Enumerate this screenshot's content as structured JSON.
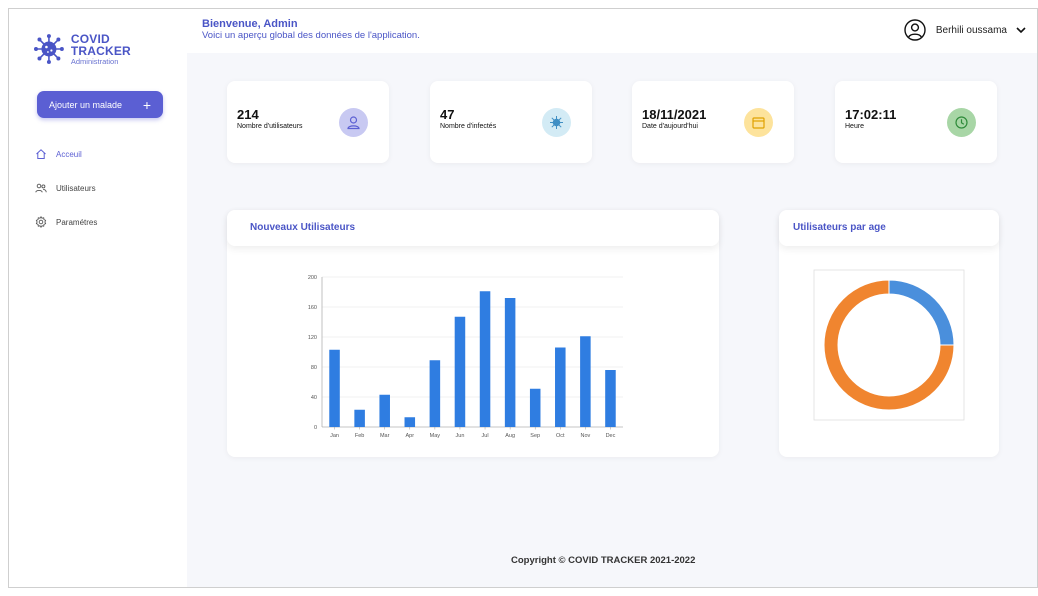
{
  "brand": {
    "title": "COVID TRACKER",
    "subtitle": "Administration",
    "accent": "#5b5fd3"
  },
  "sidebar": {
    "add_button": {
      "label": "Ajouter un malade",
      "icon": "plus-icon"
    },
    "items": [
      {
        "label": "Acceuil",
        "icon": "home-icon",
        "active": true
      },
      {
        "label": "Utilisateurs",
        "icon": "users-icon",
        "active": false
      },
      {
        "label": "Paramétres",
        "icon": "gear-icon",
        "active": false
      }
    ]
  },
  "header": {
    "title": "Bienvenue, Admin",
    "subtitle": "Voici un aperçu global des données de l'application.",
    "user_name": "Berhili oussama"
  },
  "stats": [
    {
      "value": "214",
      "label": "Nombre d'utilisateurs",
      "icon": "user-icon",
      "color": "#c8c9f2"
    },
    {
      "value": "47",
      "label": "Nombre d'infectés",
      "icon": "virus-icon",
      "color": "#d3ebf5"
    },
    {
      "value": "18/11/2021",
      "label": "Date d'aujourd'hui",
      "icon": "calendar-icon",
      "color": "#fde39c"
    },
    {
      "value": "17:02:11",
      "label": "Heure",
      "icon": "clock-icon",
      "color": "#a8d6a6"
    }
  ],
  "panels": {
    "new_users_title": "Nouveaux Utilisateurs",
    "age_title": "Utilisateurs par age"
  },
  "chart_data": [
    {
      "type": "bar",
      "title": "Nouveaux Utilisateurs",
      "categories": [
        "Jan",
        "Feb",
        "Mar",
        "Apr",
        "May",
        "Jun",
        "Jul",
        "Aug",
        "Sep",
        "Oct",
        "Nov",
        "Dec"
      ],
      "values": [
        103,
        23,
        43,
        13,
        89,
        147,
        181,
        172,
        51,
        106,
        121,
        76
      ],
      "ylim": [
        0,
        200
      ],
      "yticks": [
        0,
        40,
        80,
        120,
        160,
        200
      ],
      "grid": true,
      "color": "#2f7de1"
    },
    {
      "type": "pie",
      "title": "Utilisateurs par age",
      "values": [
        25,
        75
      ],
      "colors": [
        "#4a8fdc",
        "#f0852f"
      ],
      "donut": true
    }
  ],
  "footer": {
    "text": "Copyright © COVID TRACKER 2021-2022"
  }
}
